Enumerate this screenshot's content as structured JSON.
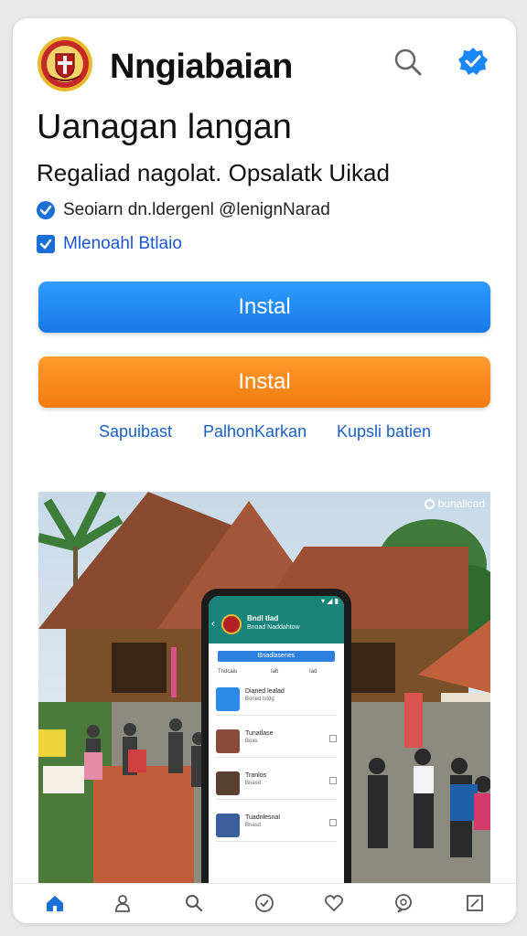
{
  "header": {
    "app_title": "Nngiabaian",
    "logo_icon": "crest-logo-icon",
    "search_icon": "search-icon",
    "verified_icon": "verified-badge-icon"
  },
  "headline": "Uanagan langan",
  "subheadline": "Regaliad nagolat. Opsalatk Uikad",
  "checks": [
    {
      "label": "Seoiarn dn.ldergenl @lenignNarad",
      "icon": "check-circle-icon"
    },
    {
      "label": "Mlenoahl Btlaio",
      "icon": "checkbox-checked-icon"
    }
  ],
  "buttons": {
    "primary_label": "Instal",
    "secondary_label": "Instal",
    "primary_color": "#1a86f5",
    "secondary_color": "#f5820f"
  },
  "links": [
    "Sapuibast",
    "PalhonKarkan",
    "Kupsli batien"
  ],
  "photo": {
    "watermark": "bunalicad",
    "phone_screen": {
      "status": "▾ ◢ ▮",
      "title": "Bndl tlad",
      "subtitle": "Bnoad Naddahtow",
      "bar_label": "Bnadlasenes",
      "tabs": [
        "Tndcaiu",
        "Iab",
        "Iad"
      ],
      "items": [
        {
          "title": "Dianed lealad",
          "sub": "Boned lstdg"
        },
        {
          "title": "Tunatlase",
          "sub": "Boas"
        },
        {
          "title": "Tranlos",
          "sub": "Bnasd"
        },
        {
          "title": "Tuadnlesnal",
          "sub": "Bnasd"
        }
      ]
    }
  },
  "tabbar": {
    "active_color": "#1a6fd6",
    "items": [
      {
        "name": "home-icon"
      },
      {
        "name": "profile-icon"
      },
      {
        "name": "search-icon"
      },
      {
        "name": "compass-icon"
      },
      {
        "name": "heart-icon"
      },
      {
        "name": "chat-icon"
      },
      {
        "name": "edit-icon"
      }
    ]
  }
}
